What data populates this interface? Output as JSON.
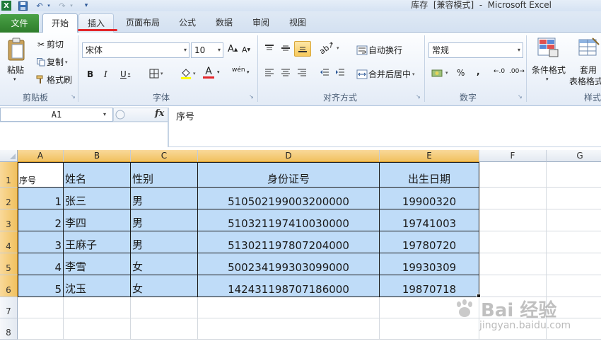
{
  "window": {
    "title": "库存  [兼容模式]  -  Microsoft Excel"
  },
  "tabs": [
    {
      "label": "文件"
    },
    {
      "label": "开始"
    },
    {
      "label": "插入"
    },
    {
      "label": "页面布局"
    },
    {
      "label": "公式"
    },
    {
      "label": "数据"
    },
    {
      "label": "审阅"
    },
    {
      "label": "视图"
    }
  ],
  "ribbon": {
    "clipboard": {
      "paste_label": "粘贴",
      "cut_label": "剪切",
      "copy_label": "复制",
      "format_painter_label": "格式刷",
      "group_label": "剪贴板"
    },
    "font": {
      "font_name": "宋体",
      "font_size": "10",
      "bold": "B",
      "italic": "I",
      "underline": "U",
      "grow": "A",
      "shrink": "A",
      "font_color_glyph": "A",
      "phonetic_glyph": "wén",
      "group_label": "字体"
    },
    "alignment": {
      "wrap_text_label": "自动换行",
      "merge_center_label": "合并后居中",
      "group_label": "对齐方式"
    },
    "number": {
      "format": "常规",
      "percent": "%",
      "comma": ",",
      "group_label": "数字"
    },
    "styles": {
      "conditional_format_label": "条件格式",
      "table_format_label_1": "套用",
      "table_format_label_2": "表格格式",
      "group_label": "样式"
    }
  },
  "formula_bar": {
    "name_box": "A1",
    "fx": "fx",
    "content": "序号"
  },
  "sheet": {
    "columns": [
      "A",
      "B",
      "C",
      "D",
      "E",
      "F",
      "G"
    ],
    "rows": [
      "1",
      "2",
      "3",
      "4",
      "5",
      "6",
      "7",
      "8"
    ],
    "header": [
      "序号",
      "姓名",
      "性别",
      "身份证号",
      "出生日期"
    ],
    "data": [
      [
        "1",
        "张三",
        "男",
        "510502199003200000",
        "19900320"
      ],
      [
        "2",
        "李四",
        "男",
        "510321197410030000",
        "19741003"
      ],
      [
        "3",
        "王麻子",
        "男",
        "513021197807204000",
        "19780720"
      ],
      [
        "4",
        "李雪",
        "女",
        "500234199303099000",
        "19930309"
      ],
      [
        "5",
        "沈玉",
        "女",
        "142431198707186000",
        "19870718"
      ]
    ]
  },
  "watermark": {
    "logo": "Bai 经验",
    "url": "jingyan.baidu.com"
  },
  "colors": {
    "selection_fill": "#bfdcf8",
    "header_selected": "#f1c15f",
    "file_tab": "#2e7d2b",
    "highlight_underline": "#e3262a"
  }
}
